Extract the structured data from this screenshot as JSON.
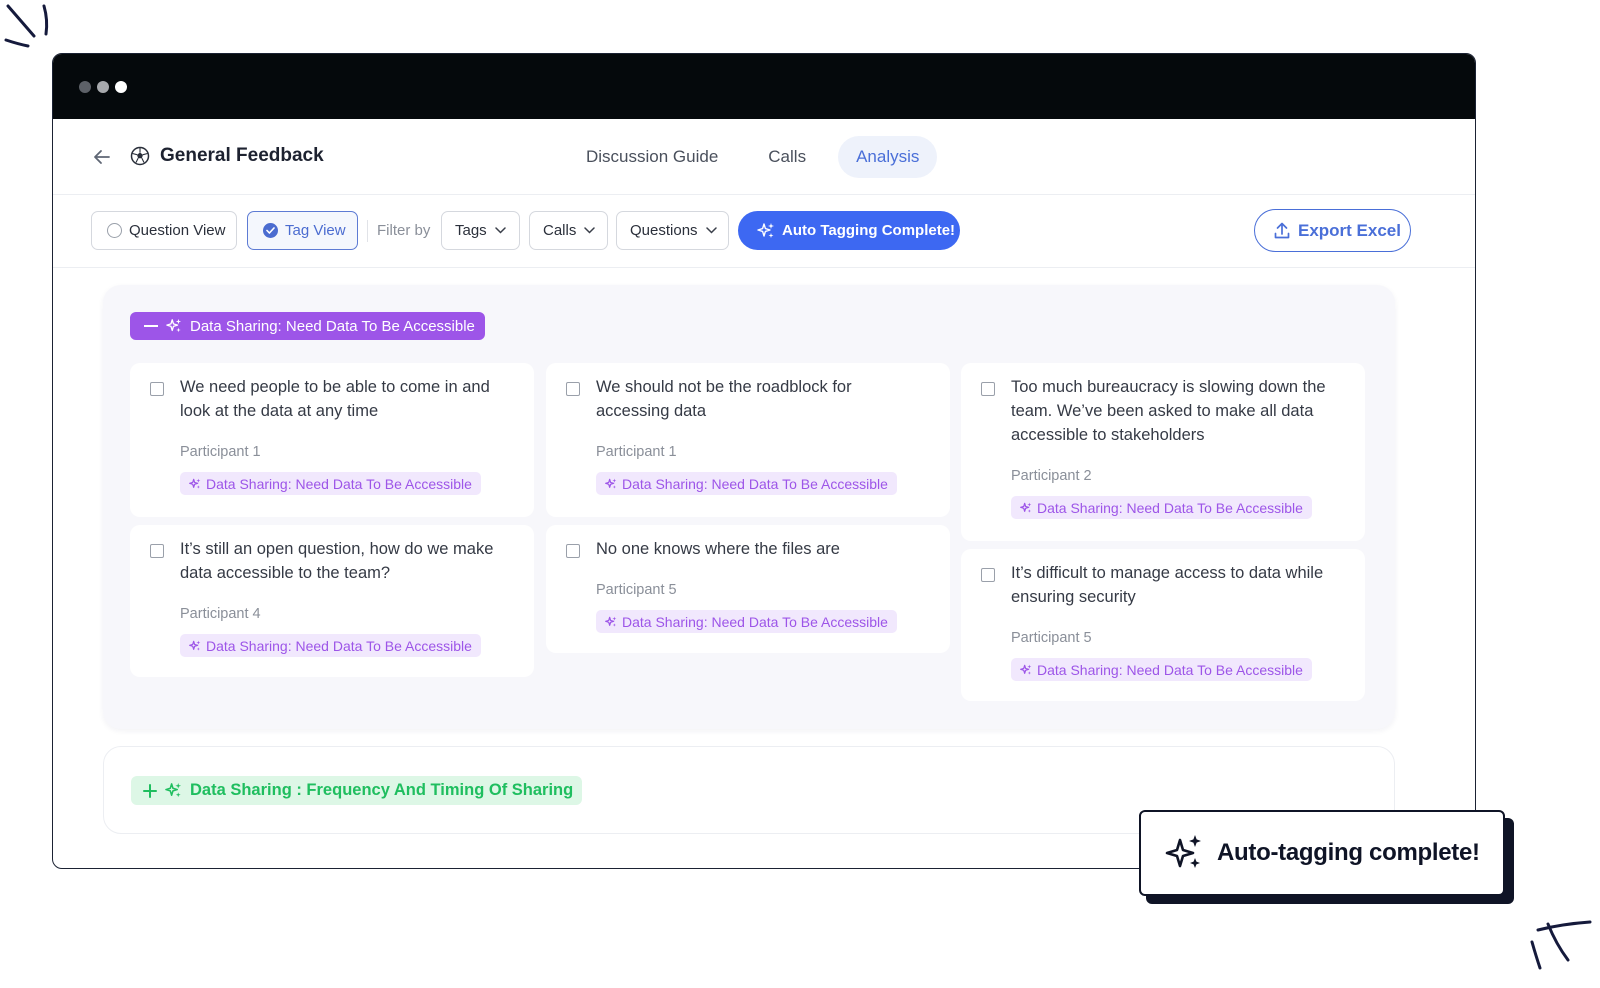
{
  "app": {
    "project_title": "General Feedback",
    "tabs": [
      {
        "label": "Discussion Guide",
        "active": false
      },
      {
        "label": "Calls",
        "active": false
      },
      {
        "label": "Analysis",
        "active": true
      }
    ]
  },
  "toolbar": {
    "question_view": "Question View",
    "tag_view": "Tag View",
    "filter_by": "Filter by",
    "filters": [
      "Tags",
      "Calls",
      "Questions"
    ],
    "auto_tagging": "Auto Tagging Complete!",
    "export": "Export Excel"
  },
  "groups": [
    {
      "tag": "Data Sharing: Need Data To Be Accessible",
      "expanded": true,
      "color": "#9d55e8",
      "cards": [
        {
          "quote_lines": [
            "We need people to be able to come in and",
            "look at the data at any time"
          ],
          "participant": "Participant 1",
          "tag": "Data Sharing: Need Data To Be Accessible"
        },
        {
          "quote_lines": [
            "We should not be the roadblock for",
            "accessing data"
          ],
          "participant": "Participant 1",
          "tag": "Data Sharing: Need Data To Be Accessible"
        },
        {
          "quote_lines": [
            "Too much bureaucracy is slowing down the",
            "team. We’ve been asked to make all data",
            "accessible to stakeholders"
          ],
          "participant": "Participant 2",
          "tag": "Data Sharing: Need Data To Be Accessible"
        },
        {
          "quote_lines": [
            "It’s still an open question, how do we make",
            "data accessible to the team?"
          ],
          "participant": "Participant 4",
          "tag": "Data Sharing: Need Data To Be Accessible"
        },
        {
          "quote_lines": [
            "No one knows where the files are"
          ],
          "participant": "Participant 5",
          "tag": "Data Sharing: Need Data To Be Accessible"
        },
        {
          "quote_lines": [
            "It’s difficult to manage access to data while",
            "ensuring security"
          ],
          "participant": "Participant 5",
          "tag": "Data Sharing: Need Data To Be Accessible"
        }
      ]
    },
    {
      "tag": "Data Sharing : Frequency And Timing Of Sharing",
      "expanded": false,
      "color": "#1fbe5f"
    }
  ],
  "toast": {
    "text": "Auto-tagging complete!"
  },
  "colors": {
    "accent_blue": "#3d68f2",
    "tag_purple": "#9d55e8",
    "tag_green": "#1fbe5f",
    "titlebar": "#05090c"
  },
  "icons": [
    "back-arrow-icon",
    "soccer-ball-icon",
    "sparkle-icon",
    "check-circle-icon",
    "chevron-down-icon",
    "upload-icon",
    "minus-icon",
    "plus-icon"
  ]
}
